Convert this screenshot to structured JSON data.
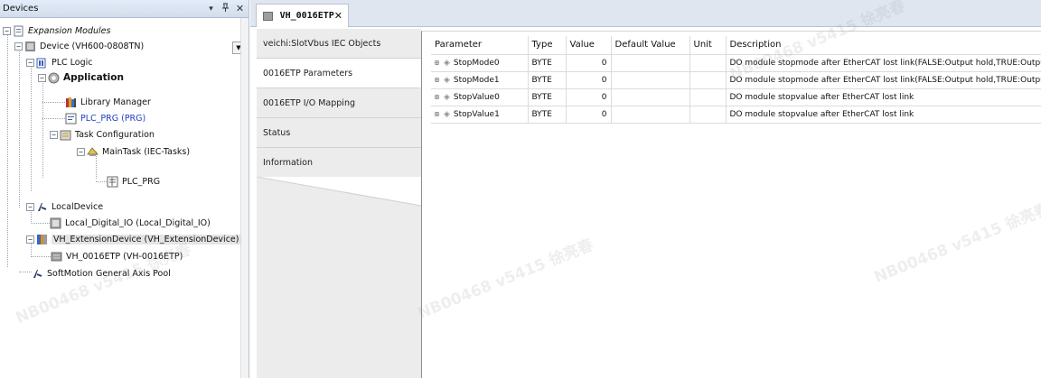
{
  "devices_panel": {
    "title": "Devices",
    "pin_glyph": "▾",
    "dock_glyph": "ᵽ",
    "close_glyph": "✕",
    "tree": [
      {
        "label": "Expansion Modules",
        "style": "italic",
        "icon": "project-icon"
      },
      {
        "label": "Device (VH600-0808TN)",
        "icon": "device-icon"
      },
      {
        "label": "PLC Logic",
        "icon": "plc-logic-icon"
      },
      {
        "label": "Application",
        "style": "bold",
        "icon": "application-icon"
      },
      {
        "label": "Library Manager",
        "icon": "library-manager-icon"
      },
      {
        "label": "PLC_PRG (PRG)",
        "style": "blue",
        "icon": "program-icon"
      },
      {
        "label": "Task Configuration",
        "icon": "task-configuration-icon"
      },
      {
        "label": "MainTask (IEC-Tasks)",
        "icon": "task-icon"
      },
      {
        "label": "PLC_PRG",
        "icon": "program-call-icon"
      },
      {
        "label": "LocalDevice",
        "icon": "local-device-icon"
      },
      {
        "label": "Local_Digital_IO (Local_Digital_IO)",
        "icon": "io-module-icon"
      },
      {
        "label": "VH_ExtensionDevice (VH_ExtensionDevice)",
        "icon": "extension-device-icon"
      },
      {
        "label": "VH_0016ETP (VH-0016ETP)",
        "icon": "etp-module-icon"
      },
      {
        "label": "SoftMotion General Axis Pool",
        "icon": "axis-pool-icon"
      }
    ]
  },
  "editor": {
    "doc_tab_label": "VH_0016ETP",
    "doc_tab_close": "✕",
    "side_tabs": [
      {
        "label": "veichi:SlotVbus IEC Objects"
      },
      {
        "label": "0016ETP Parameters"
      },
      {
        "label": "0016ETP I/O Mapping"
      },
      {
        "label": "Status"
      },
      {
        "label": "Information"
      }
    ],
    "active_side_tab": 1,
    "table": {
      "headers": [
        "Parameter",
        "Type",
        "Value",
        "Default Value",
        "Unit",
        "Description"
      ],
      "rows": [
        {
          "parameter": "StopMode0",
          "type": "BYTE",
          "value": "0",
          "default": "",
          "unit": "",
          "description": "DO module stopmode after EtherCAT lost link(FALSE:Output hold,TRUE:Outpu"
        },
        {
          "parameter": "StopMode1",
          "type": "BYTE",
          "value": "0",
          "default": "",
          "unit": "",
          "description": "DO module stopmode after EtherCAT lost link(FALSE:Output hold,TRUE:Outpu"
        },
        {
          "parameter": "StopValue0",
          "type": "BYTE",
          "value": "0",
          "default": "",
          "unit": "",
          "description": "DO module stopvalue after EtherCAT lost link"
        },
        {
          "parameter": "StopValue1",
          "type": "BYTE",
          "value": "0",
          "default": "",
          "unit": "",
          "description": "DO module stopvalue after EtherCAT lost link"
        }
      ]
    }
  },
  "watermark": {
    "text": "NB00468 v5415 徐亮春"
  }
}
